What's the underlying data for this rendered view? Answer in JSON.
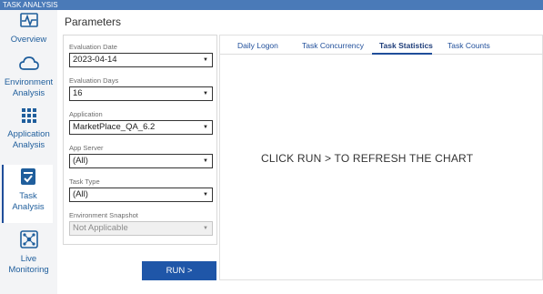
{
  "window": {
    "title": "TASK ANALYSIS"
  },
  "sidebar": {
    "items": [
      {
        "label": "Overview",
        "icon": "pulse-chart-icon"
      },
      {
        "label": "Environment Analysis",
        "icon": "cloud-icon"
      },
      {
        "label": "Application Analysis",
        "icon": "grid-icon"
      },
      {
        "label": "Task Analysis",
        "icon": "checklist-icon"
      },
      {
        "label": "Live Monitoring",
        "icon": "network-icon"
      }
    ]
  },
  "parameters": {
    "title": "Parameters",
    "fields": [
      {
        "label": "Evaluation Date",
        "value": "2023-04-14"
      },
      {
        "label": "Evaluation Days",
        "value": "16"
      },
      {
        "label": "Application",
        "value": "MarketPlace_QA_6.2"
      },
      {
        "label": "App Server",
        "value": "(All)"
      },
      {
        "label": "Task Type",
        "value": "(All)"
      },
      {
        "label": "Environment Snapshot",
        "value": "Not Applicable"
      }
    ],
    "run_label": "RUN >"
  },
  "tabs": [
    {
      "label": "Daily Logon"
    },
    {
      "label": "Task Concurrency"
    },
    {
      "label": "Task Statistics"
    },
    {
      "label": "Task Counts"
    }
  ],
  "chart": {
    "message": "CLICK RUN > TO REFRESH THE CHART"
  }
}
